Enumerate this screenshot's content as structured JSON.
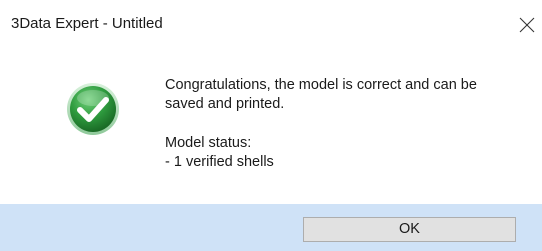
{
  "window": {
    "title": "3Data Expert - Untitled",
    "close_icon": "close-icon"
  },
  "dialog": {
    "icon": "checkmark-success-icon",
    "icon_color": "#2e8b3d",
    "message_line1": "Congratulations, the model is correct and can be",
    "message_line2": "saved and printed.",
    "status_heading": "Model status:",
    "status_items": [
      " - 1 verified shells"
    ]
  },
  "footer": {
    "ok_label": "OK",
    "background": "#cfe2f7"
  }
}
